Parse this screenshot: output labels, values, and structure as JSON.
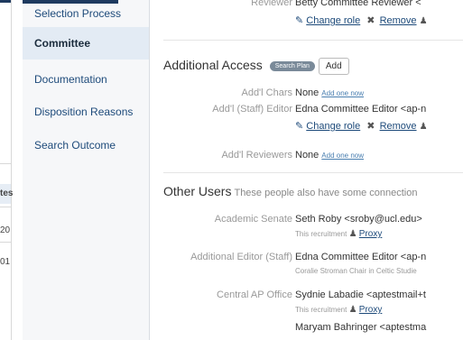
{
  "left_strip": {
    "frag_header": "tes",
    "frag_1": "20",
    "frag_2": "01"
  },
  "sidebar": {
    "items": [
      {
        "label": "Selection Process"
      },
      {
        "label": "Committee"
      },
      {
        "label": "Documentation"
      },
      {
        "label": "Disposition Reasons"
      },
      {
        "label": "Search Outcome"
      }
    ]
  },
  "top": {
    "label": "Reviewer",
    "value": "Betty Committee Reviewer <",
    "change_role": "Change role",
    "remove": "Remove"
  },
  "additional_access": {
    "title": "Additional Access",
    "pill": "Search Plan",
    "add_button": "Add",
    "rows": [
      {
        "label": "Add'l Chars",
        "value": "None",
        "add_link": "Add one now"
      },
      {
        "label": "Add'l (Staff) Editor",
        "value": "Edna Committee Editor <ap-n",
        "change_role": "Change role",
        "remove": "Remove"
      },
      {
        "label": "Add'l Reviewers",
        "value": "None",
        "add_link": "Add one now"
      }
    ]
  },
  "other_users": {
    "title": "Other Users",
    "description": "These people also have some connection",
    "rows": [
      {
        "label": "Academic Senate",
        "value": "Seth Roby <sroby@ucl.edu>",
        "sub": "This recruitment",
        "proxy": "Proxy"
      },
      {
        "label": "Additional Editor (Staff)",
        "value": "Edna Committee Editor <ap-n",
        "sub": "Coralie Stroman Chair in Celtic Studie"
      },
      {
        "label": "Central AP Office",
        "value": "Sydnie Labadie <aptestmail+t",
        "sub": "This recruitment",
        "proxy": "Proxy"
      },
      {
        "label": "",
        "value": "Maryam Bahringer <aptestma"
      }
    ]
  }
}
